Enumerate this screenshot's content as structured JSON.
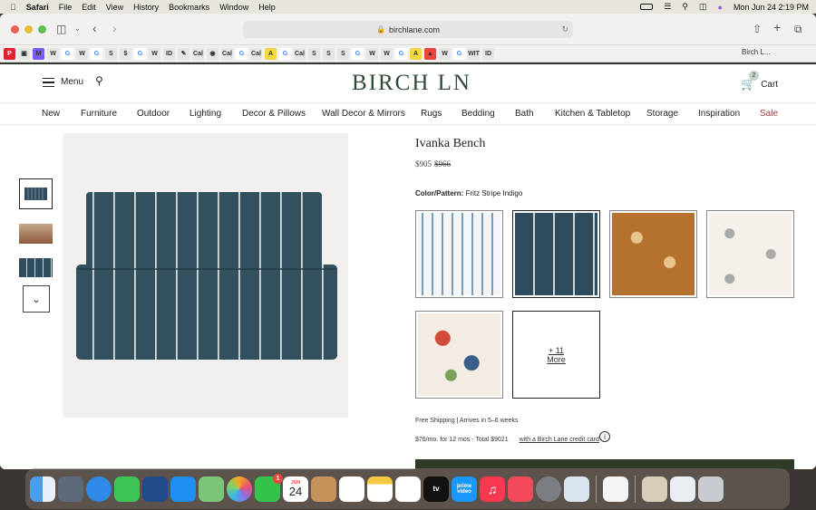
{
  "menubar": {
    "app": "Safari",
    "items": [
      "File",
      "Edit",
      "View",
      "History",
      "Bookmarks",
      "Window",
      "Help"
    ],
    "datetime": "Mon Jun 24  2:19 PM"
  },
  "browser": {
    "url": "birchlane.com",
    "favorites": [
      "P",
      "▣",
      "M",
      "W",
      "G",
      "W",
      "G",
      "S",
      "$",
      "G",
      "W",
      "ID",
      "✎",
      "Cal",
      "◉",
      "Cal",
      "G",
      "Cal",
      "A",
      "G",
      "Cal",
      "S",
      "S",
      "S",
      "G",
      "W",
      "W",
      "G",
      "A",
      "▲",
      "W",
      "G",
      "WIT",
      "ID"
    ],
    "open_tab": "Birch L..."
  },
  "site": {
    "menu_label": "Menu",
    "logo": "BIRCH LN",
    "cart_label": "Cart",
    "cart_count": "2",
    "nav": [
      "New",
      "Furniture",
      "Outdoor",
      "Lighting",
      "Decor & Pillows",
      "Wall Decor & Mirrors",
      "Rugs",
      "Bedding",
      "Bath",
      "Kitchen & Tabletop",
      "Storage",
      "Inspiration",
      "Sale"
    ]
  },
  "product": {
    "title": "Ivanka Bench",
    "price": "$905",
    "old_price": "$966",
    "color_label": "Color/Pattern:",
    "color_value": "Fritz Stripe Indigo",
    "more_count": "+ 11",
    "more_label": "More",
    "shipping": "Free Shipping   |   Arrives in 5–6 weeks",
    "financing": "$76/mo. for 12 mos - Total $9021",
    "financing_link": "with a Birch Lane credit card",
    "info_icon_glyph": "i"
  },
  "dock": {
    "calendar_month": "JUN",
    "calendar_day": "24",
    "facetime_badge": "1",
    "tv_label": "tv",
    "prime_label": "prime video"
  },
  "colors": {
    "brand": "#2f4a33",
    "sale": "#b0362b",
    "indigo": "#2e4c5e"
  }
}
